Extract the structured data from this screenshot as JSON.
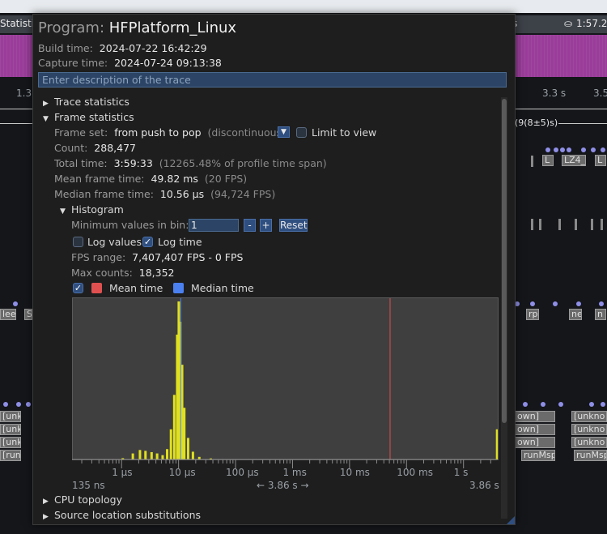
{
  "background": {
    "tab_left": "Statistic",
    "tab_right": "s",
    "clock": "1:57.2",
    "time_labels": [
      "1.3",
      "3.3 s",
      "3.5"
    ],
    "right_bracket": "(9(8±5)s)",
    "blocks_right": [
      "L",
      "LZ4_",
      "L"
    ],
    "blocks_mid_left": [
      "leep",
      "S"
    ],
    "blocks_mid_right": [
      "rp",
      "ne",
      "n"
    ],
    "unk_left": [
      "[unk",
      "[unk",
      "[unk",
      "[runl"
    ],
    "unk_right_a": [
      "own]",
      "own]",
      "own]",
      "runMsp"
    ],
    "unk_right_b": [
      "[unkno",
      "[unkno",
      "[unkno",
      "runMsp"
    ]
  },
  "window": {
    "program_label": "Program:",
    "program_name": "HFPlatform_Linux",
    "build_label": "Build time:",
    "build_time": "2024-07-22 16:42:29",
    "capture_label": "Capture time:",
    "capture_time": "2024-07-24 09:13:38",
    "description_placeholder": "Enter description of the trace"
  },
  "sections": {
    "trace_statistics": "Trace statistics",
    "frame_statistics": "Frame statistics",
    "cpu_topology": "CPU topology",
    "source_location": "Source location substitutions"
  },
  "frame": {
    "frameset_label": "Frame set:",
    "frameset_value": "from push to pop",
    "frameset_note": "(discontinuous)",
    "limit_label": "Limit to view",
    "count_label": "Count:",
    "count_value": "288,477",
    "total_label": "Total time:",
    "total_value": "3:59:33",
    "total_note": "(12265.48% of profile time span)",
    "mean_label": "Mean frame time:",
    "mean_value": "49.82 ms",
    "mean_note": "(20 FPS)",
    "median_label": "Median frame time:",
    "median_value": "10.56 μs",
    "median_note": "(94,724 FPS)"
  },
  "histogram": {
    "title": "Histogram",
    "min_label": "Minimum values in bin:",
    "min_value": "1",
    "minus": "-",
    "plus": "+",
    "reset": "Reset",
    "log_values": "Log values",
    "log_time": "Log time",
    "fps_label": "FPS range:",
    "fps_value": "7,407,407 FPS - 0 FPS",
    "max_label": "Max counts:",
    "max_value": "18,352",
    "mean_time": "Mean time",
    "median_time": "Median time",
    "axis_min": "135 ns",
    "axis_max": "3.86 s",
    "axis_span": "← 3.86 s →",
    "colors": {
      "bars": "#e0e020",
      "mean": "#e05050",
      "median": "#4a80f0",
      "plot_bg": "#3f3f3f"
    }
  },
  "chart_data": {
    "type": "bar",
    "xlabel": "",
    "ylabel": "",
    "x_scale": "log",
    "tick_labels": [
      "1 μs",
      "10 μs",
      "100 μs",
      "1 ms",
      "10 ms",
      "100 ms",
      "1 s"
    ],
    "tick_values_s": [
      1e-06,
      1e-05,
      0.0001,
      0.001,
      0.01,
      0.1,
      1
    ],
    "x_range_s": [
      1.35e-07,
      3.86
    ],
    "max_count": 18352,
    "log_values": false,
    "mean_time_s": 0.04982,
    "median_time_s": 1.056e-05,
    "bins": [
      {
        "t": 1e-06,
        "v": 150
      },
      {
        "t": 1.5e-06,
        "v": 700
      },
      {
        "t": 2e-06,
        "v": 1100
      },
      {
        "t": 2.5e-06,
        "v": 1000
      },
      {
        "t": 3.2e-06,
        "v": 850
      },
      {
        "t": 4e-06,
        "v": 700
      },
      {
        "t": 5e-06,
        "v": 500
      },
      {
        "t": 6e-06,
        "v": 1200
      },
      {
        "t": 7e-06,
        "v": 3500
      },
      {
        "t": 8e-06,
        "v": 7500
      },
      {
        "t": 9e-06,
        "v": 14500
      },
      {
        "t": 9.6e-06,
        "v": 18352
      },
      {
        "t": 1.02e-05,
        "v": 16000
      },
      {
        "t": 1.1e-05,
        "v": 11000
      },
      {
        "t": 1.2e-05,
        "v": 6000
      },
      {
        "t": 1.4e-05,
        "v": 2500
      },
      {
        "t": 1.7e-05,
        "v": 900
      },
      {
        "t": 2.2e-05,
        "v": 300
      },
      {
        "t": 3.5e-05,
        "v": 120
      },
      {
        "t": 8e-05,
        "v": 40
      },
      {
        "t": 0.0003,
        "v": 15
      },
      {
        "t": 3.7,
        "v": 3500
      }
    ]
  }
}
